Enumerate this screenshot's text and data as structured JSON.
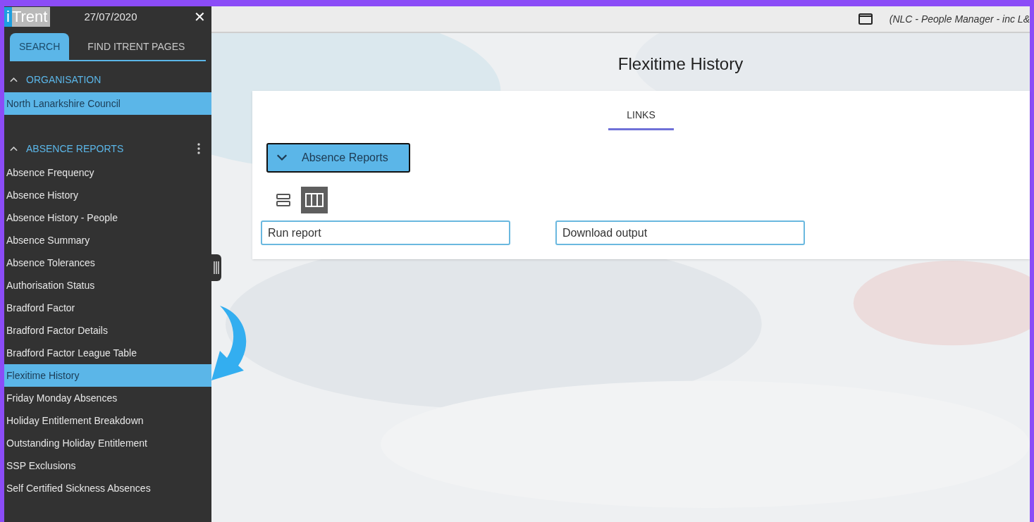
{
  "sidebar": {
    "logo": {
      "letter": "i",
      "word": "Trent"
    },
    "date": "27/07/2020",
    "close": "✕",
    "tabs": [
      {
        "label": "SEARCH",
        "selected": true
      },
      {
        "label": "FIND ITRENT PAGES",
        "selected": false
      }
    ],
    "sections": [
      {
        "title": "ORGANISATION",
        "expanded": true,
        "items": [
          {
            "label": "North Lanarkshire Council",
            "selected": true
          }
        ]
      },
      {
        "title": "ABSENCE REPORTS",
        "expanded": true,
        "menu": true,
        "items": [
          {
            "label": "Absence Frequency",
            "selected": false
          },
          {
            "label": "Absence History",
            "selected": false
          },
          {
            "label": "Absence History - People",
            "selected": false
          },
          {
            "label": "Absence Summary",
            "selected": false
          },
          {
            "label": "Absence Tolerances",
            "selected": false
          },
          {
            "label": "Authorisation Status",
            "selected": false
          },
          {
            "label": "Bradford Factor",
            "selected": false
          },
          {
            "label": "Bradford Factor Details",
            "selected": false
          },
          {
            "label": "Bradford Factor League Table",
            "selected": false
          },
          {
            "label": "Flexitime History",
            "selected": true
          },
          {
            "label": "Friday Monday Absences",
            "selected": false
          },
          {
            "label": "Holiday Entitlement Breakdown",
            "selected": false
          },
          {
            "label": "Outstanding Holiday Entitlement",
            "selected": false
          },
          {
            "label": "SSP Exclusions",
            "selected": false
          },
          {
            "label": "Self Certified Sickness Absences",
            "selected": false
          }
        ]
      }
    ]
  },
  "topbar": {
    "context": "(NLC - People Manager - inc L&"
  },
  "page": {
    "title": "Flexitime History",
    "tabs": [
      {
        "label": "LINKS",
        "selected": true
      }
    ],
    "group": {
      "label": "Absence Reports",
      "expanded": true
    },
    "views": [
      {
        "kind": "rows",
        "selected": false
      },
      {
        "kind": "columns",
        "selected": true
      }
    ],
    "links": [
      {
        "label": "Run report"
      },
      {
        "label": "Download output"
      }
    ]
  }
}
